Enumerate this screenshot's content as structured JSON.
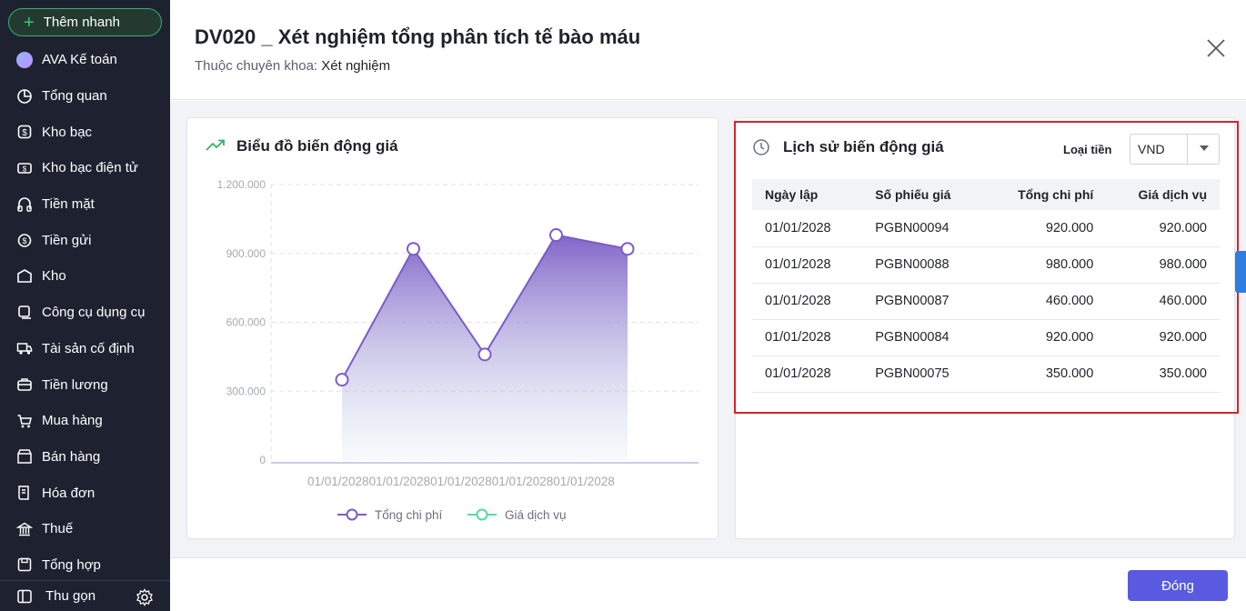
{
  "sidebar": {
    "quick_add": "Thêm nhanh",
    "items": [
      {
        "label": "AVA Kế toán",
        "icon": "ava-avatar-icon"
      },
      {
        "label": "Tổng quan",
        "icon": "pie-chart-icon"
      },
      {
        "label": "Kho bạc",
        "icon": "treasury-icon"
      },
      {
        "label": "Kho bạc điện tử",
        "icon": "e-treasury-icon"
      },
      {
        "label": "Tiền mặt",
        "icon": "cash-icon"
      },
      {
        "label": "Tiền gửi",
        "icon": "deposit-icon"
      },
      {
        "label": "Kho",
        "icon": "warehouse-icon"
      },
      {
        "label": "Công cụ dụng cụ",
        "icon": "tools-icon"
      },
      {
        "label": "Tài sản cố định",
        "icon": "truck-icon"
      },
      {
        "label": "Tiền lương",
        "icon": "salary-icon"
      },
      {
        "label": "Mua hàng",
        "icon": "cart-icon"
      },
      {
        "label": "Bán hàng",
        "icon": "sales-icon"
      },
      {
        "label": "Hóa đơn",
        "icon": "invoice-icon"
      },
      {
        "label": "Thuế",
        "icon": "bank-icon"
      },
      {
        "label": "Tổng hợp",
        "icon": "save-icon"
      }
    ],
    "collapse_label": "Thu gọn"
  },
  "dialog": {
    "title": "DV020 _ Xét nghiệm tổng phân tích tế bào máu",
    "subtitle_label": "Thuộc chuyên khoa:",
    "subtitle_value": "Xét nghiệm",
    "close_label": "Đóng"
  },
  "chart_card": {
    "title": "Biểu đồ biến động giá"
  },
  "chart_data": {
    "type": "area",
    "title": "Biểu đồ biến động giá",
    "categories": [
      "01/01/2028",
      "01/01/2028",
      "01/01/2028",
      "01/01/2028",
      "01/01/2028"
    ],
    "x_tick_text": "01/01/202801/01/202801/01/202801/01/202801/01/2028",
    "y_ticks": [
      "1.200.000",
      "900.000",
      "600.000",
      "300.000",
      "0"
    ],
    "ylim": [
      0,
      1200000
    ],
    "grid": true,
    "legend_position": "bottom",
    "series": [
      {
        "name": "Tổng chi phí",
        "values": [
          350000,
          920000,
          460000,
          980000,
          920000
        ],
        "color": "#7b5cc6"
      },
      {
        "name": "Giá dịch vụ",
        "values": [],
        "color": "#57d9a0"
      }
    ]
  },
  "history": {
    "title": "Lịch sử biến động giá",
    "currency_label": "Loại tiền",
    "currency_value": "VND",
    "columns": [
      "Ngày lập",
      "Số phiếu giá",
      "Tổng chi phí",
      "Giá dịch vụ"
    ],
    "rows": [
      {
        "date": "01/01/2028",
        "code": "PGBN00094",
        "cost": "920.000",
        "price": "920.000"
      },
      {
        "date": "01/01/2028",
        "code": "PGBN00088",
        "cost": "980.000",
        "price": "980.000"
      },
      {
        "date": "01/01/2028",
        "code": "PGBN00087",
        "cost": "460.000",
        "price": "460.000"
      },
      {
        "date": "01/01/2028",
        "code": "PGBN00084",
        "cost": "920.000",
        "price": "920.000"
      },
      {
        "date": "01/01/2028",
        "code": "PGBN00075",
        "cost": "350.000",
        "price": "350.000"
      }
    ]
  },
  "colors": {
    "sidebar_bg": "#1e2230",
    "accent_green": "#2fb36b",
    "primary_button": "#5a5ae0",
    "link": "#2574d3",
    "highlight_border": "#d6232b"
  }
}
